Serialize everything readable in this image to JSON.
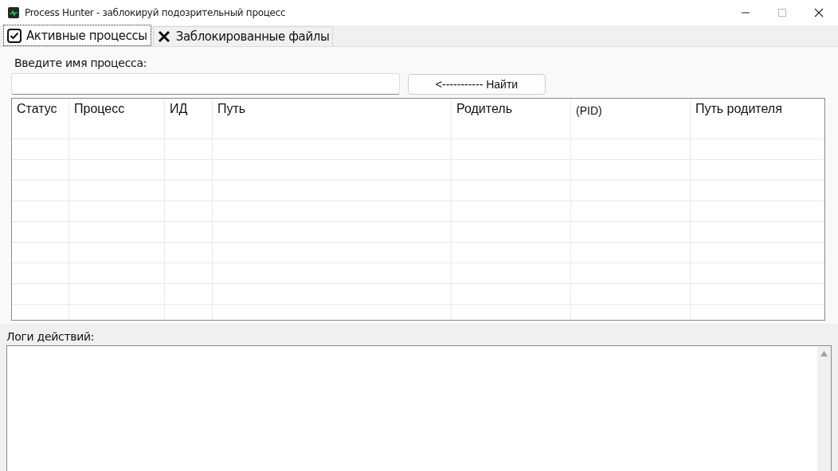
{
  "window": {
    "title": "Process Hunter - заблокируй подозрительный процесс"
  },
  "tabs": [
    {
      "label": "Активные процессы",
      "selected": true
    },
    {
      "label": "Заблокированные файлы",
      "selected": false
    }
  ],
  "search": {
    "label": "Введите имя процесса:",
    "button": "<----------- Найти"
  },
  "table": {
    "columns": [
      "Статус",
      "Процесс",
      "ИД",
      "Путь",
      "Родитель",
      "(PID)",
      "Путь родителя"
    ]
  },
  "logs": {
    "label": "Логи действий:"
  }
}
